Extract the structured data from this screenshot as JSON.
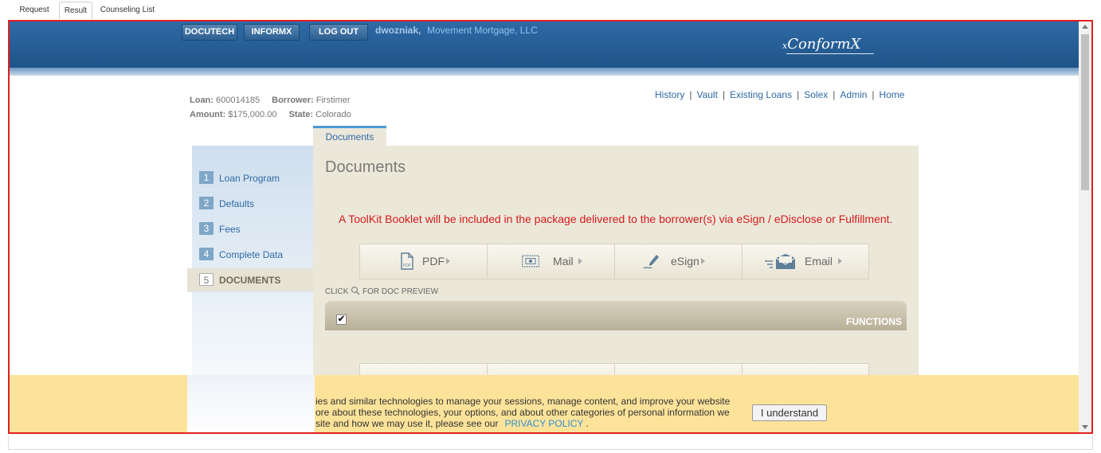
{
  "outer_tabs": [
    "Request",
    "Result",
    "Counseling List"
  ],
  "header": {
    "buttons": [
      "DOCUTECH",
      "INFORMX",
      "LOG OUT"
    ],
    "username": "dwozniak,",
    "company": "Movement Mortgage, LLC",
    "logo_prefix": "x",
    "logo": "ConformX",
    "colors": {
      "header_blue": "#1e5488",
      "link_blue": "#2f6aa5"
    }
  },
  "loan": {
    "loan_label": "Loan:",
    "loan_value": "600014185",
    "borrower_label": "Borrower:",
    "borrower_value": "Firstimer",
    "amount_label": "Amount:",
    "amount_value": "$175,000.00",
    "state_label": "State:",
    "state_value": "Colorado"
  },
  "topnav": [
    "History",
    "Vault",
    "Existing Loans",
    "Solex",
    "Admin",
    "Home"
  ],
  "sidebar": {
    "items": [
      {
        "num": "1",
        "label": "Loan Program"
      },
      {
        "num": "2",
        "label": "Defaults"
      },
      {
        "num": "3",
        "label": "Fees"
      },
      {
        "num": "4",
        "label": "Complete Data"
      },
      {
        "num": "5",
        "label": "DOCUMENTS"
      }
    ]
  },
  "content": {
    "tab": "Documents",
    "title": "Documents",
    "notice": "A ToolKit Booklet will be included in the package delivered to the borrower(s) via eSign / eDisclose or Fulfillment.",
    "delivery": [
      {
        "label": "PDF",
        "icon": "pdf-icon"
      },
      {
        "label": "Mail",
        "icon": "mail-stamp-icon"
      },
      {
        "label": "eSign",
        "icon": "esign-pen-icon"
      },
      {
        "label": "Email",
        "icon": "email-envelope-icon"
      }
    ],
    "preview_hint_prefix": "CLICK",
    "preview_hint_suffix": "FOR DOC PREVIEW",
    "functions_label": "FUNCTIONS",
    "checkbox_mark": "✔"
  },
  "cookie": {
    "line1": "ies and similar technologies to manage your sessions, manage content, and improve your website",
    "line2": "ore about these technologies, your options, and about other categories of personal information we",
    "line3": "site and how we may use it, please see our",
    "link": "PRIVACY POLICY",
    "period": ".",
    "button": "I understand",
    "color": "#fde39a"
  }
}
